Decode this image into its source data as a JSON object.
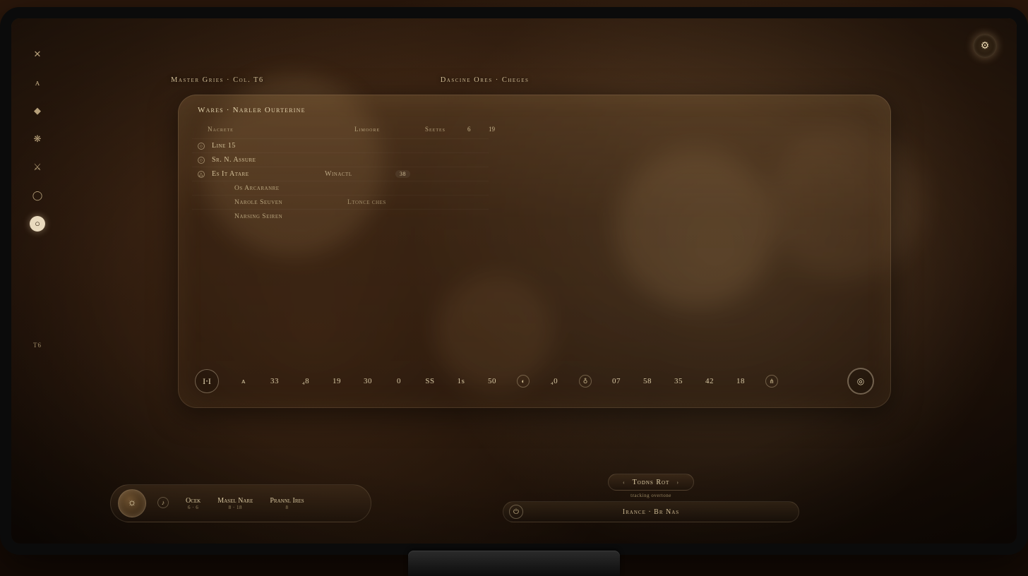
{
  "sidebar": {
    "items": [
      {
        "icon": "✕"
      },
      {
        "icon": "ᴀ"
      },
      {
        "icon": "◆"
      },
      {
        "icon": "❋"
      },
      {
        "icon": "⚔"
      },
      {
        "icon": "◯"
      },
      {
        "icon": "○",
        "active": true
      }
    ],
    "footer_label": "T6"
  },
  "corner_badge": "⚙",
  "headers": {
    "left": "Master Gries · Col. T6",
    "right": "Dascine Ores · Cheges"
  },
  "panel": {
    "title": "Wares · Narler Ourterine",
    "sub_a": "Nacrete",
    "sub_b": "Limoore",
    "sub_c": "Seetes",
    "val_b": "6",
    "val_c": "19",
    "rows": [
      {
        "icon": "○",
        "name": "Line 15",
        "col2": "",
        "tag": ""
      },
      {
        "icon": "○",
        "name": "Sr. N. Assure",
        "col2": "",
        "tag": ""
      },
      {
        "icon": "△",
        "name": "Es It Atare",
        "col2": "Winactl",
        "tag": "38"
      },
      {
        "indent": true,
        "name": "Os Arcaranre"
      },
      {
        "indent": true,
        "name": "Narole Seuven",
        "col2": "Ltonce ches"
      },
      {
        "indent": true,
        "name": "Narsing Seiren"
      }
    ]
  },
  "readout": {
    "left_button": "I⋅I",
    "values": [
      "ᴀ",
      "33",
      "₄8",
      "19",
      "30",
      "0",
      "SS",
      "1s",
      "50",
      "",
      "₄0",
      "",
      "07",
      "58",
      "35",
      "42",
      "18",
      ""
    ],
    "right_button": "◎"
  },
  "dock": {
    "power_icon": "☼",
    "items": [
      {
        "icon": "♪",
        "label": "",
        "sub": ""
      },
      {
        "icon": "",
        "label": "Ocek",
        "sub": "6 · 6"
      },
      {
        "icon": "",
        "label": "Masel Nare",
        "sub": "8 · 18"
      },
      {
        "icon": "",
        "label": "Prannl Ires",
        "sub": "8"
      }
    ],
    "selector": {
      "label": "Todns Rot",
      "chev_l": "‹",
      "chev_r": "›",
      "sub": "tracking overtone"
    },
    "search": {
      "icon": "⏻",
      "label": "Irance · Br Nas"
    }
  }
}
